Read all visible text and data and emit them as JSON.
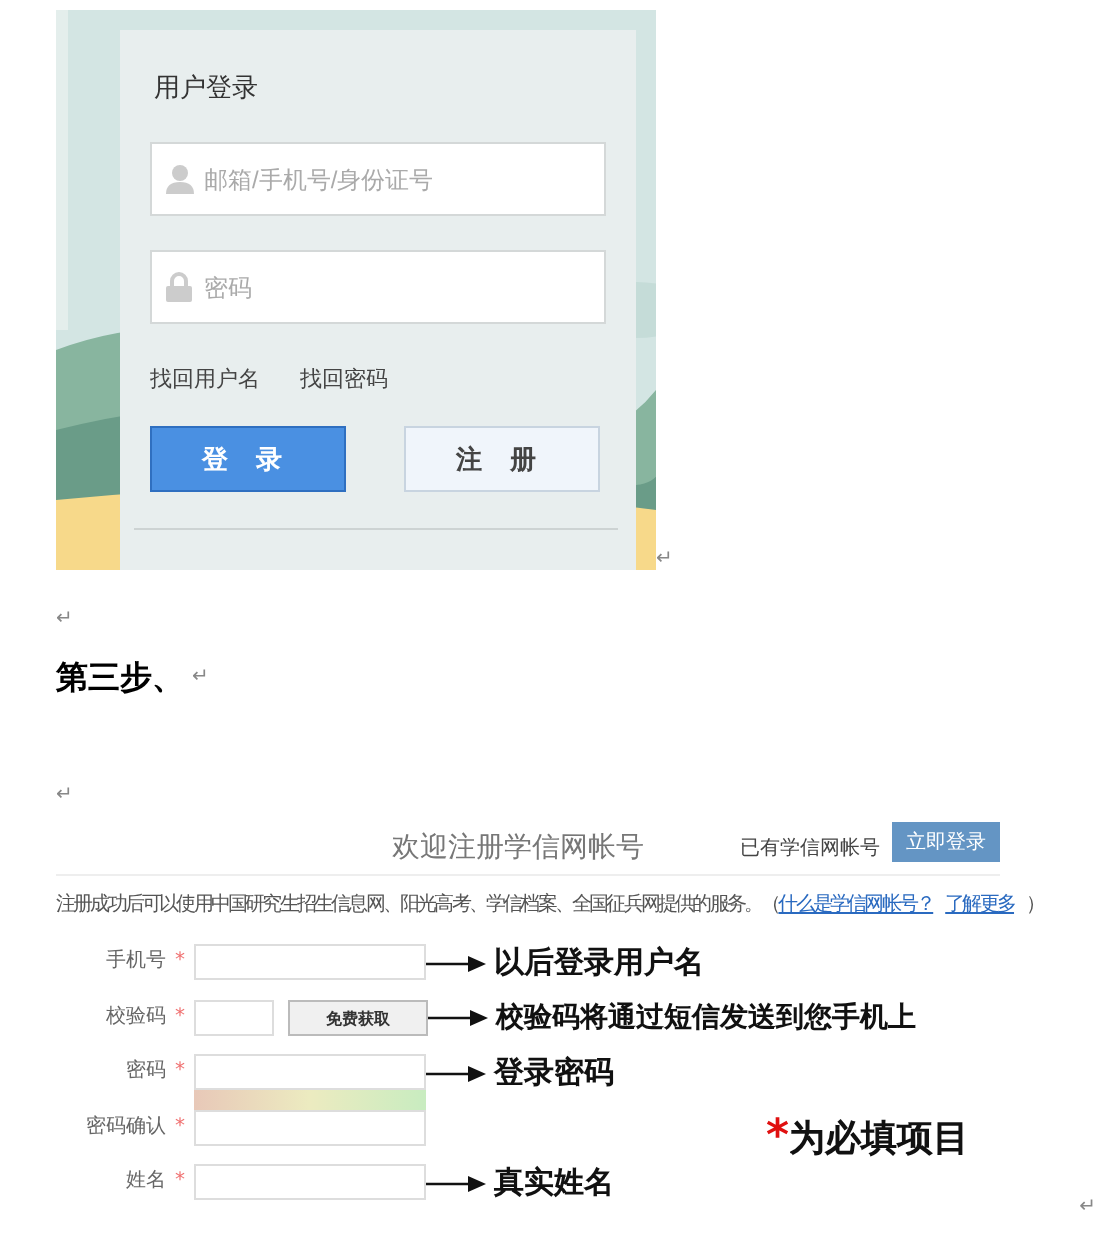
{
  "paragraphs": [
    {
      "kind": "login_image",
      "mark": "↵",
      "login": {
        "title": "用户登录",
        "fields": [
          {
            "kind": "user",
            "placeholder": "邮箱/手机号/身份证号"
          },
          {
            "kind": "lock",
            "placeholder": "密码"
          }
        ],
        "links": [
          "找回用户名",
          "找回密码"
        ],
        "buttons": [
          {
            "label": "登录",
            "primary": true
          },
          {
            "label": "注册",
            "primary": false
          }
        ]
      }
    },
    {
      "kind": "blank",
      "mark": "↵"
    },
    {
      "kind": "heading",
      "text": "第三步、",
      "mark": "↵"
    },
    {
      "kind": "blank",
      "mark": "↵"
    },
    {
      "kind": "register_image",
      "mark": "↵",
      "register": {
        "title": "欢迎注册学信网帐号",
        "has_account": "已有学信网帐号",
        "login_button": "立即登录",
        "notice": "注册成功后可以使用中国研究生招生信息网、阳光高考、学信档案、全国征兵网提供的服务。（",
        "notice_links": [
          "什么是学信网帐号？",
          "了解更多"
        ],
        "notice_end": "）",
        "fields": [
          {
            "label": "手机号",
            "required_mark": "*",
            "kind": "text",
            "annotation": "以后登录用户名"
          },
          {
            "label": "校验码",
            "required_mark": "*",
            "kind": "code",
            "button": "免费获取",
            "annotation": "校验码将通过短信发送到您手机上"
          },
          {
            "label": "密码",
            "required_mark": "*",
            "kind": "password",
            "annotation": "登录密码"
          },
          {
            "label": "密码确认",
            "required_mark": "*",
            "kind": "text"
          },
          {
            "label": "姓名",
            "required_mark": "*",
            "kind": "text",
            "annotation": "真实姓名"
          }
        ],
        "required_note": {
          "mark": "*",
          "text": "为必填项目"
        }
      }
    }
  ]
}
